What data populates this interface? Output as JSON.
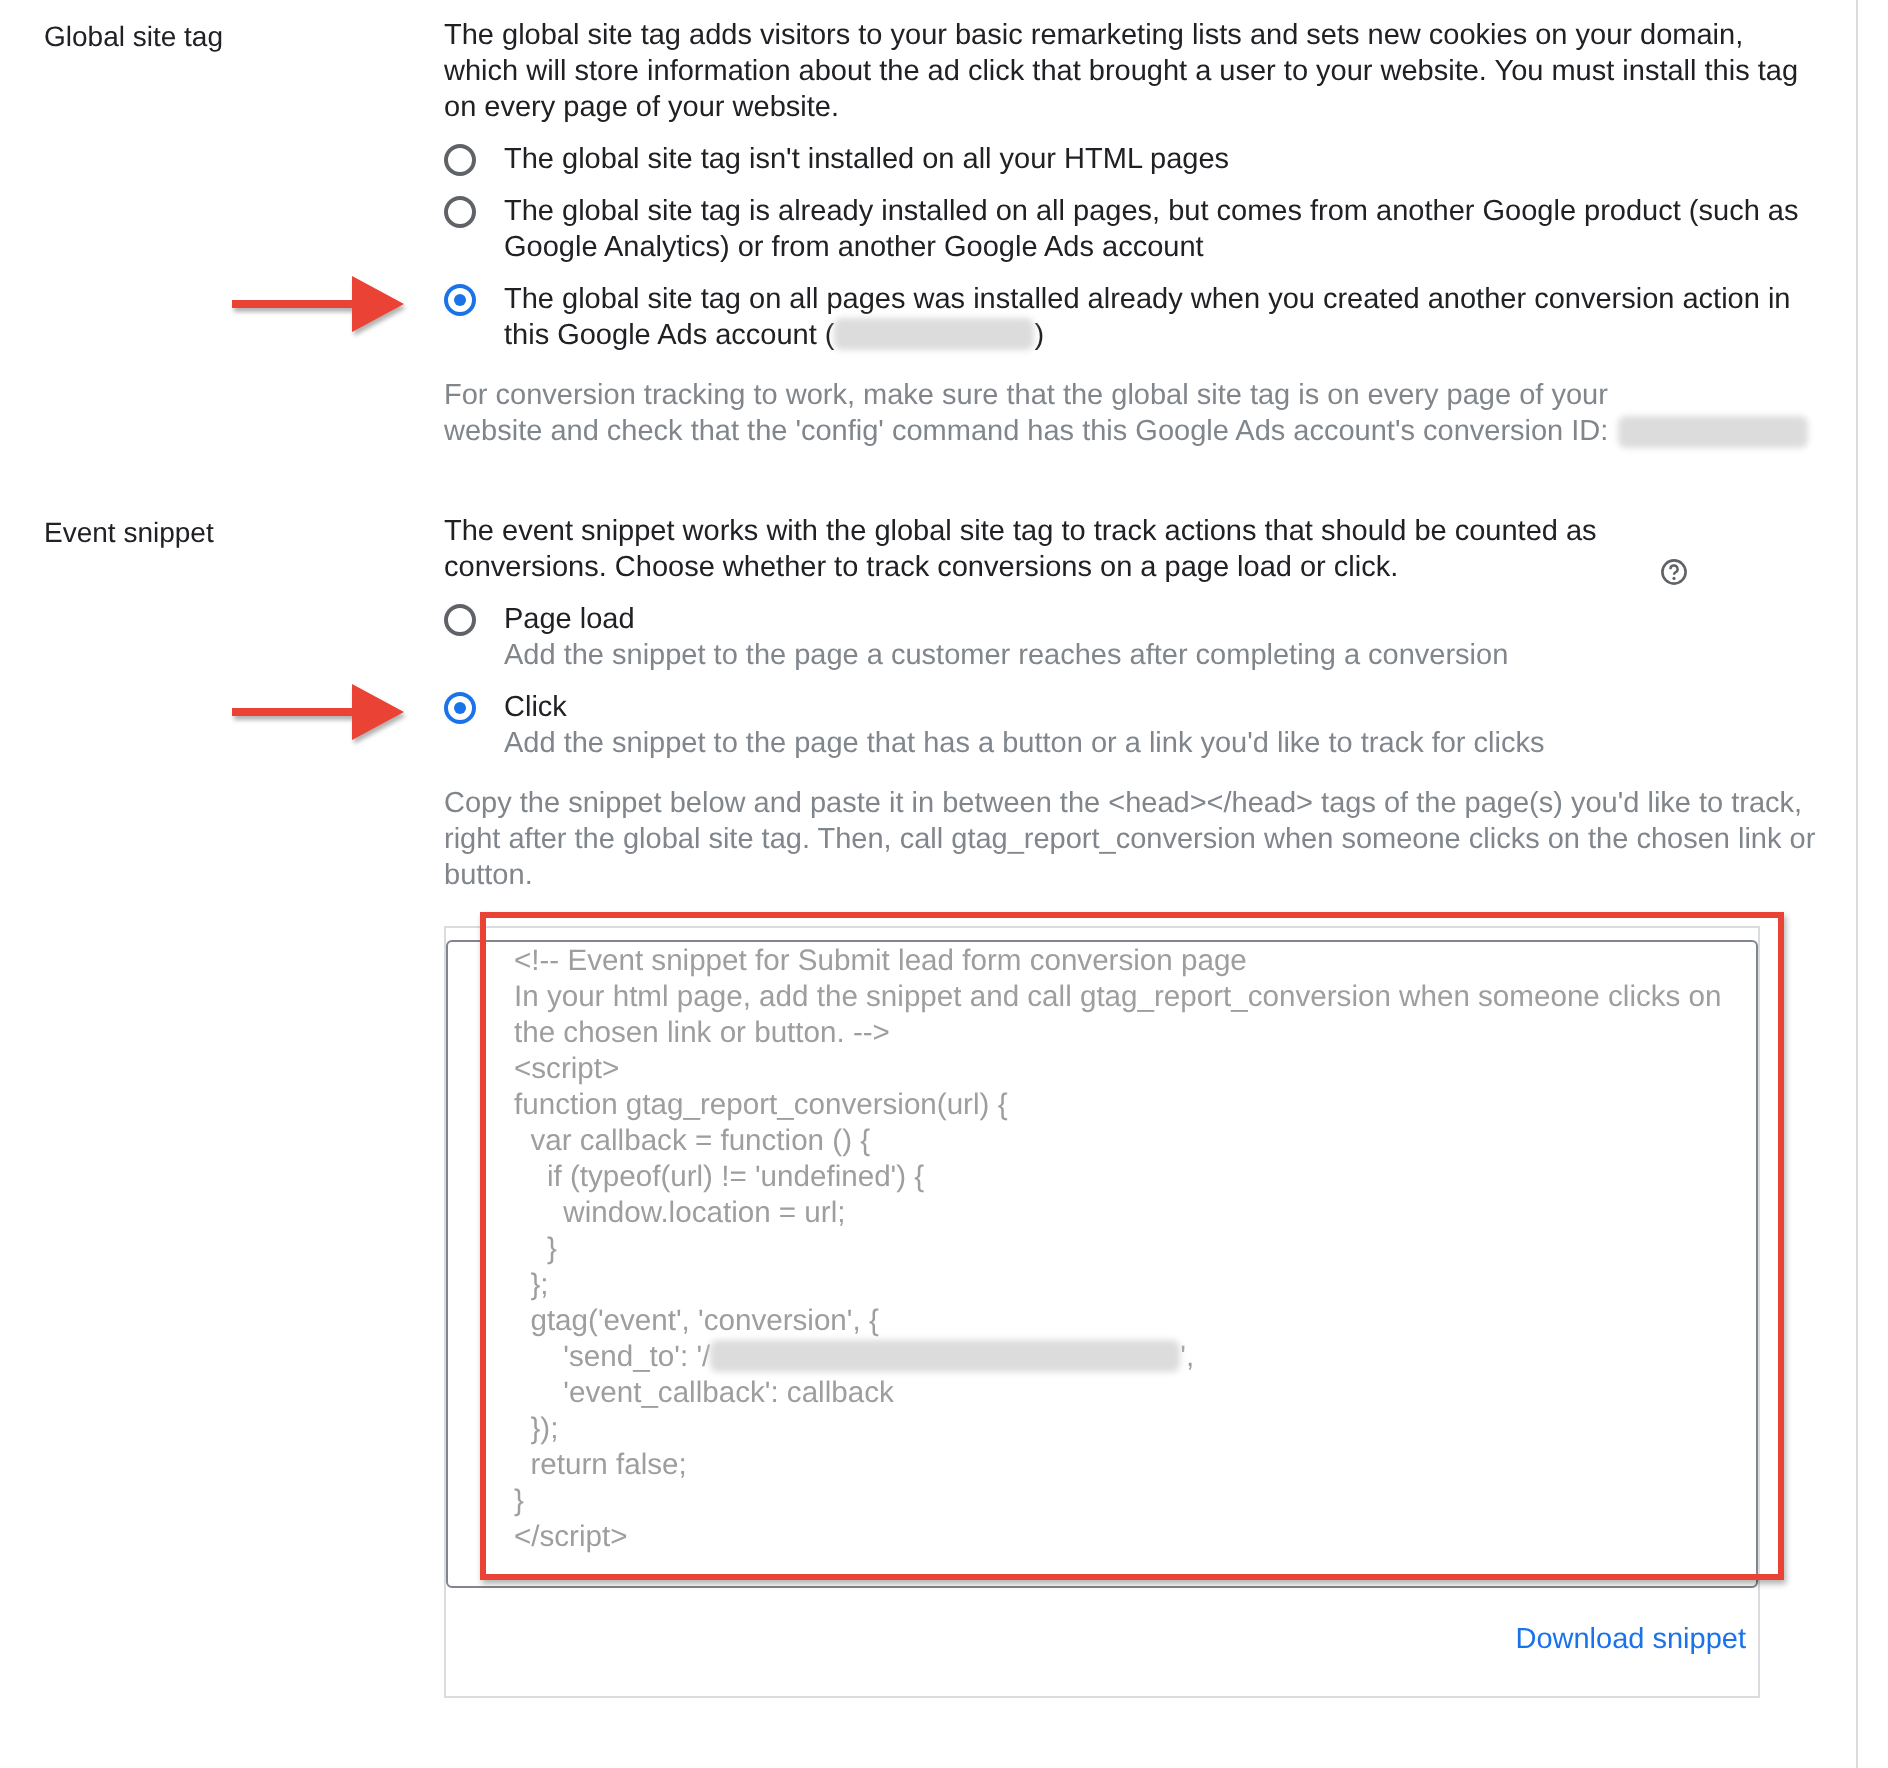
{
  "sections": [
    {
      "label": "Global site tag",
      "description": "The global site tag adds visitors to your basic remarketing lists and sets new cookies on your domain, which will store information about the ad click that brought a user to your website. You must install this tag on every page of your website.",
      "help": false,
      "options": [
        {
          "text": "The global site tag isn't installed on all your HTML pages",
          "selected": false,
          "pointed": false
        },
        {
          "text": "The global site tag is already installed on all pages, but comes from another Google product (such as Google Analytics) or from another Google Ads account",
          "selected": false,
          "pointed": false
        },
        {
          "text": "The global site tag on all pages was installed already when you created another conversion action in this Google Ads account (",
          "after": ")",
          "redacted": true,
          "selected": true,
          "pointed": true
        }
      ],
      "note": "For conversion tracking to work, make sure that the global site tag is on every page of your website and check that the 'config' command has this Google Ads account's conversion ID:",
      "note_redacted": true
    },
    {
      "label": "Event snippet",
      "description": "The event snippet works with the global site tag to track actions that should be counted as conversions. Choose whether to track conversions on a page load or click.",
      "help": true,
      "options": [
        {
          "text": "Page load",
          "hint": "Add the snippet to the page a customer reaches after completing a conversion",
          "selected": false,
          "pointed": false
        },
        {
          "text": "Click",
          "hint": "Add the snippet to the page that has a button or a link you'd like to track for clicks",
          "selected": true,
          "pointed": true
        }
      ],
      "note": "Copy the snippet below and paste it in between the <head></head> tags of the page(s) you'd like to track, right after the global site tag. Then, call gtag_report_conversion when someone clicks on the chosen link or button.",
      "note_redacted": false,
      "snippet": {
        "highlighted": true,
        "lines": [
          {
            "text": "<!-- Event snippet for Submit lead form conversion page"
          },
          {
            "text": "In your html page, add the snippet and call gtag_report_conversion when someone clicks on"
          },
          {
            "text": "the chosen link or button. -->"
          },
          {
            "text": "<script>"
          },
          {
            "text": "function gtag_report_conversion(url) {"
          },
          {
            "text": "  var callback = function () {"
          },
          {
            "text": "    if (typeof(url) != 'undefined') {"
          },
          {
            "text": "      window.location = url;"
          },
          {
            "text": "    }"
          },
          {
            "text": "  };"
          },
          {
            "text": "  gtag('event', 'conversion', {"
          },
          {
            "text": "      'send_to': '/",
            "redacted": true,
            "after": "',"
          },
          {
            "text": "      'event_callback': callback"
          },
          {
            "text": "  });"
          },
          {
            "text": "  return false;"
          },
          {
            "text": "}"
          },
          {
            "text": "</script>"
          }
        ],
        "action": "Download snippet"
      }
    }
  ]
}
